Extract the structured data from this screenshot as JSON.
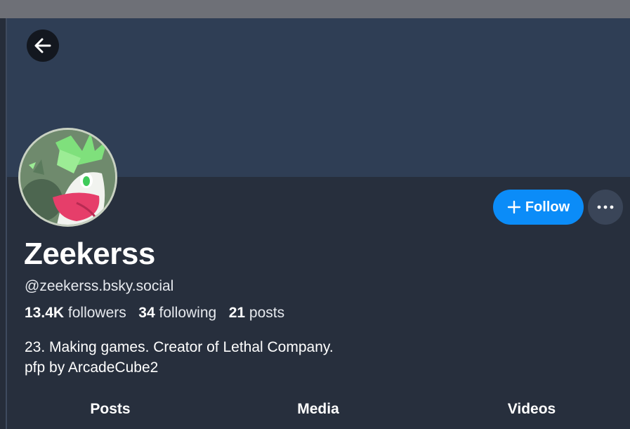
{
  "profile": {
    "display_name": "Zeekerss",
    "handle": "@zeekerss.bsky.social",
    "stats": {
      "followers_count": "13.4K",
      "followers_label": "followers",
      "following_count": "34",
      "following_label": "following",
      "posts_count": "21",
      "posts_label": "posts"
    },
    "bio": {
      "line1": "23. Making games. Creator of Lethal Company.",
      "line2": "pfp by ArcadeCube2"
    }
  },
  "actions": {
    "follow_label": "Follow",
    "back_icon": "arrow-left-icon",
    "more_icon": "ellipsis-icon"
  },
  "tabs": [
    {
      "label": "Posts"
    },
    {
      "label": "Media"
    },
    {
      "label": "Videos"
    }
  ],
  "colors": {
    "banner": "#2f3e55",
    "background": "#272f3d",
    "accent": "#0b8cf8"
  }
}
